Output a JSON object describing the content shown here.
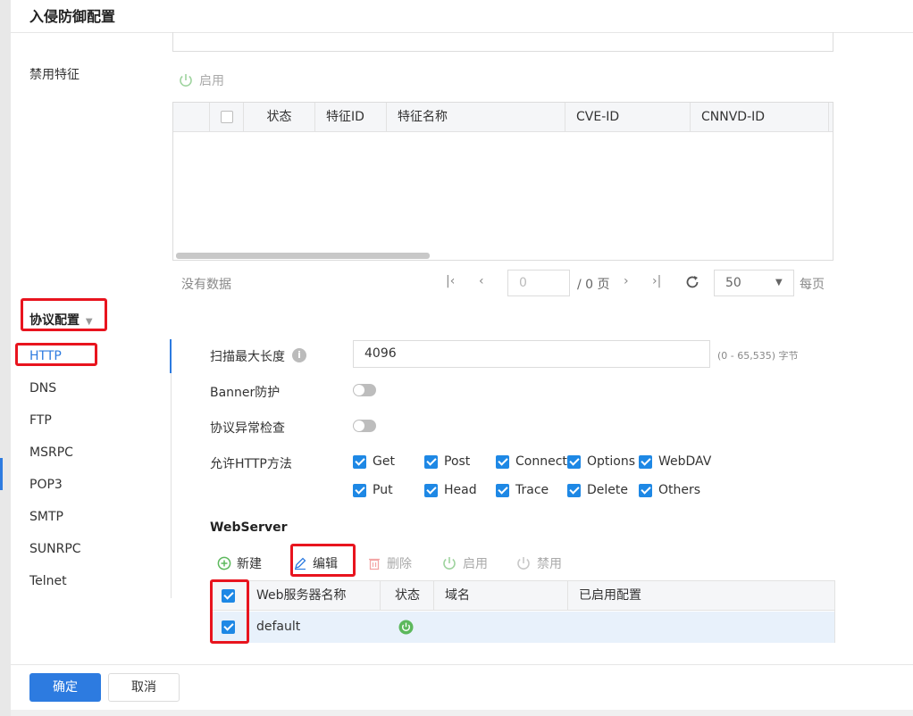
{
  "dialog_title": "入侵防御配置",
  "disabled_features": {
    "label": "禁用特征",
    "enable_btn": "启用",
    "columns": [
      "状态",
      "特征ID",
      "特征名称",
      "CVE-ID",
      "CNNVD-ID"
    ],
    "no_data": "没有数据",
    "pager": {
      "page_input": "0",
      "page_total": "/ 0 页",
      "page_size": "50",
      "per_page": "每页"
    }
  },
  "protocol_config": {
    "label": "协议配置",
    "items": [
      "HTTP",
      "DNS",
      "FTP",
      "MSRPC",
      "POP3",
      "SMTP",
      "SUNRPC",
      "Telnet"
    ],
    "active": "HTTP"
  },
  "http": {
    "scan_max_len_label": "扫描最大长度",
    "scan_max_len_value": "4096",
    "scan_max_len_hint": "(0 - 65,535) 字节",
    "banner_label": "Banner防护",
    "banner_on": false,
    "proto_check_label": "协议异常检查",
    "proto_check_on": false,
    "methods_label": "允许HTTP方法",
    "methods_row1": [
      "Get",
      "Post",
      "Connect",
      "Options",
      "WebDAV"
    ],
    "methods_row2": [
      "Put",
      "Head",
      "Trace",
      "Delete",
      "Others"
    ]
  },
  "webserver": {
    "title": "WebServer",
    "toolbar": {
      "new": "新建",
      "edit": "编辑",
      "delete": "删除",
      "enable": "启用",
      "disable": "禁用"
    },
    "columns": [
      "Web服务器名称",
      "状态",
      "域名",
      "已启用配置"
    ],
    "rows": [
      {
        "name": "default",
        "status": "enabled",
        "domain": "",
        "config": ""
      }
    ]
  },
  "footer": {
    "ok": "确定",
    "cancel": "取消"
  },
  "colors": {
    "primary": "#2d7be0",
    "checkbox": "#1e88e5",
    "highlight": "#e8141e",
    "enabled_green": "#5cb85c"
  }
}
